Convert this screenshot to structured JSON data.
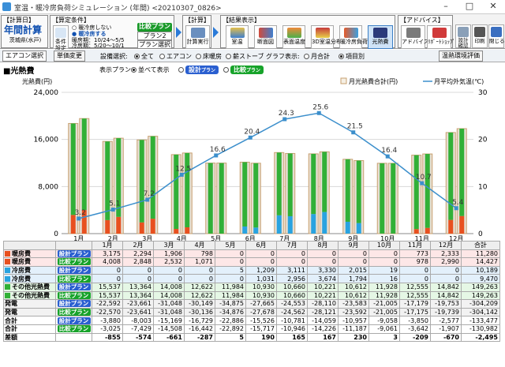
{
  "window": {
    "title": "室温・暖冷房負荷シミュレーション (年間) <20210307_0826>",
    "min_label": "–",
    "max_label": "□",
    "close_label": "✕"
  },
  "toolbar": {
    "calc_day_label": "【計算日】",
    "calc_type": "年間計算",
    "location": "茨城県(水戸)",
    "cond_label": "【算定条件】",
    "cond_button": "条件設定",
    "heat_cool_options": [
      "暖冷房しない",
      "暖冷房する"
    ],
    "heat_period": "暖房期：10/24～5/5",
    "cool_period": "冷房期：5/20～10/1",
    "compare_label": "比較プラン",
    "plan2_label": "プラン2",
    "plan_select_label": "プラン選択",
    "calc_label": "【計算】",
    "calc_button": "計算実行",
    "results_label": "【結果表示】",
    "result_buttons": [
      "室温",
      "断面図",
      "表面温度",
      "3D室温分布",
      "暖冷房負荷",
      "光熱費"
    ],
    "advice_label": "【アドバイス】",
    "advice_buttons": [
      "アドバイス",
      "ﾘﾎﾟｰﾄｼｮｯﾌﾟ"
    ],
    "right_buttons": [
      "設計確認",
      "印刷",
      "閉じる"
    ]
  },
  "toolbar2": {
    "aircon_tab": "エアコン選択",
    "unitprice_tab": "単価変更",
    "equip_label": "設備選択:",
    "equip_options": [
      "全て",
      "エアコン",
      "床暖房",
      "薪ストーブ"
    ],
    "graph_label": "グラフ表示:",
    "graph_options": [
      "月合計",
      "項目別"
    ],
    "env_button": "温熱環境評価"
  },
  "panel": {
    "title": "■光熱費",
    "plan_label": "表示プラン:",
    "plan_all": "並べて表示",
    "plan_design": "設計",
    "plan_compare": "比較",
    "plan_suffix": "プラン",
    "y_left_label": "光熱費(円)",
    "legend_bar": "月光熱費合計(円)",
    "legend_line": "月平均外気温(℃)"
  },
  "colors": {
    "heat": "#e8501f",
    "cool": "#29a3e0",
    "other": "#31b037",
    "gen": "#d9d0c3",
    "line": "#3c8fcc",
    "bar_outline": "#c8a070"
  },
  "chart_data": {
    "type": "bar",
    "categories": [
      "1月",
      "2月",
      "3月",
      "4月",
      "5月",
      "6月",
      "7月",
      "8月",
      "9月",
      "10月",
      "11月",
      "12月"
    ],
    "ylim": [
      0,
      24000
    ],
    "y2lim": [
      0,
      30
    ],
    "yticks": [
      "0",
      "8,000",
      "16,000",
      "24,000"
    ],
    "y2ticks": [
      "0",
      "10",
      "20",
      "30"
    ],
    "series": [
      {
        "name": "暖房費",
        "plan": "設計",
        "values": [
          3175,
          2294,
          1906,
          798,
          0,
          0,
          0,
          0,
          0,
          0,
          773,
          2333
        ]
      },
      {
        "name": "暖房費",
        "plan": "比較",
        "values": [
          4008,
          2848,
          2532,
          1071,
          0,
          0,
          0,
          0,
          0,
          0,
          978,
          2990
        ]
      },
      {
        "name": "冷房費",
        "plan": "設計",
        "values": [
          0,
          0,
          0,
          0,
          5,
          1209,
          3111,
          3330,
          2015,
          19,
          0,
          0
        ]
      },
      {
        "name": "冷房費",
        "plan": "比較",
        "values": [
          0,
          0,
          0,
          0,
          0,
          1031,
          2956,
          3674,
          1794,
          16,
          0,
          0
        ]
      },
      {
        "name": "その他光熱費",
        "plan": "設計",
        "values": [
          15537,
          13364,
          14008,
          12622,
          11984,
          10930,
          10660,
          10221,
          10612,
          11928,
          12555,
          14842
        ]
      },
      {
        "name": "その他光熱費",
        "plan": "比較",
        "values": [
          15537,
          13364,
          14008,
          12622,
          11984,
          10930,
          10660,
          10221,
          10612,
          11928,
          12555,
          14842
        ]
      }
    ],
    "temperature": [
      3.2,
      5.1,
      7.2,
      12.5,
      16.6,
      20.4,
      24.3,
      25.6,
      21.5,
      16.4,
      10.7,
      5.4
    ]
  },
  "table": {
    "header": [
      "",
      "",
      "1月",
      "2月",
      "3月",
      "4月",
      "5月",
      "6月",
      "7月",
      "8月",
      "9月",
      "10月",
      "11月",
      "12月",
      "合計"
    ],
    "rows": [
      {
        "cls": "r-heat",
        "label": "暖房費",
        "sw": "heat",
        "tag": "d",
        "tagtxt": "設計プラン",
        "vals": [
          "3,175",
          "2,294",
          "1,906",
          "798",
          "0",
          "0",
          "0",
          "0",
          "0",
          "0",
          "773",
          "2,333",
          "11,280"
        ]
      },
      {
        "cls": "r-heat",
        "label": "暖房費",
        "sw": "heat",
        "tag": "c",
        "tagtxt": "比較プラン",
        "vals": [
          "4,008",
          "2,848",
          "2,532",
          "1,071",
          "0",
          "0",
          "0",
          "0",
          "0",
          "0",
          "978",
          "2,990",
          "14,427"
        ]
      },
      {
        "cls": "r-cool",
        "label": "冷房費",
        "sw": "cool",
        "tag": "d",
        "tagtxt": "設計プラン",
        "vals": [
          "0",
          "0",
          "0",
          "0",
          "5",
          "1,209",
          "3,111",
          "3,330",
          "2,015",
          "19",
          "0",
          "0",
          "10,189"
        ]
      },
      {
        "cls": "r-cool",
        "label": "冷房費",
        "sw": "cool",
        "tag": "c",
        "tagtxt": "比較プラン",
        "vals": [
          "0",
          "0",
          "0",
          "0",
          "0",
          "1,031",
          "2,956",
          "3,674",
          "1,794",
          "16",
          "0",
          "0",
          "9,470"
        ]
      },
      {
        "cls": "r-oth",
        "label": "その他光熱費",
        "sw": "other",
        "tag": "d",
        "tagtxt": "設計プラン",
        "vals": [
          "15,537",
          "13,364",
          "14,008",
          "12,622",
          "11,984",
          "10,930",
          "10,660",
          "10,221",
          "10,612",
          "11,928",
          "12,555",
          "14,842",
          "149,263"
        ]
      },
      {
        "cls": "r-oth",
        "label": "その他光熱費",
        "sw": "other",
        "tag": "c",
        "tagtxt": "比較プラン",
        "vals": [
          "15,537",
          "13,364",
          "14,008",
          "12,622",
          "11,984",
          "10,930",
          "10,660",
          "10,221",
          "10,612",
          "11,928",
          "12,555",
          "14,842",
          "149,263"
        ]
      },
      {
        "cls": "r-gen",
        "label": "発電",
        "sw": "",
        "tag": "d",
        "tagtxt": "設計プラン",
        "vals": [
          "-22,592",
          "-23,661",
          "-31,048",
          "-30,149",
          "-34,875",
          "-27,665",
          "-24,553",
          "-28,110",
          "-23,583",
          "-21,005",
          "-17,179",
          "-19,753",
          "-304,209"
        ]
      },
      {
        "cls": "r-gen",
        "label": "発電",
        "sw": "",
        "tag": "c",
        "tagtxt": "比較プラン",
        "vals": [
          "-22,570",
          "-23,641",
          "-31,048",
          "-30,136",
          "-34,876",
          "-27,678",
          "-24,562",
          "-28,121",
          "-23,592",
          "-21,005",
          "-17,175",
          "-19,739",
          "-304,142"
        ]
      },
      {
        "cls": "r-sum",
        "label": "合計",
        "sw": "",
        "tag": "d",
        "tagtxt": "設計プラン",
        "vals": [
          "-3,880",
          "-8,003",
          "-15,169",
          "-16,729",
          "-22,886",
          "-15,526",
          "-10,781",
          "-14,059",
          "-10,957",
          "-9,058",
          "-3,850",
          "-2,577",
          "-133,477"
        ]
      },
      {
        "cls": "r-sum",
        "label": "合計",
        "sw": "",
        "tag": "c",
        "tagtxt": "比較プラン",
        "vals": [
          "-3,025",
          "-7,429",
          "-14,508",
          "-16,442",
          "-22,892",
          "-15,717",
          "-10,946",
          "-14,226",
          "-11,187",
          "-9,061",
          "-3,642",
          "-1,907",
          "-130,982"
        ]
      },
      {
        "cls": "r-diff",
        "label": "差額",
        "sw": "",
        "tag": "",
        "tagtxt": "",
        "vals": [
          "-855",
          "-574",
          "-661",
          "-287",
          "5",
          "190",
          "165",
          "167",
          "230",
          "3",
          "-209",
          "-670",
          "-2,495"
        ]
      }
    ]
  }
}
